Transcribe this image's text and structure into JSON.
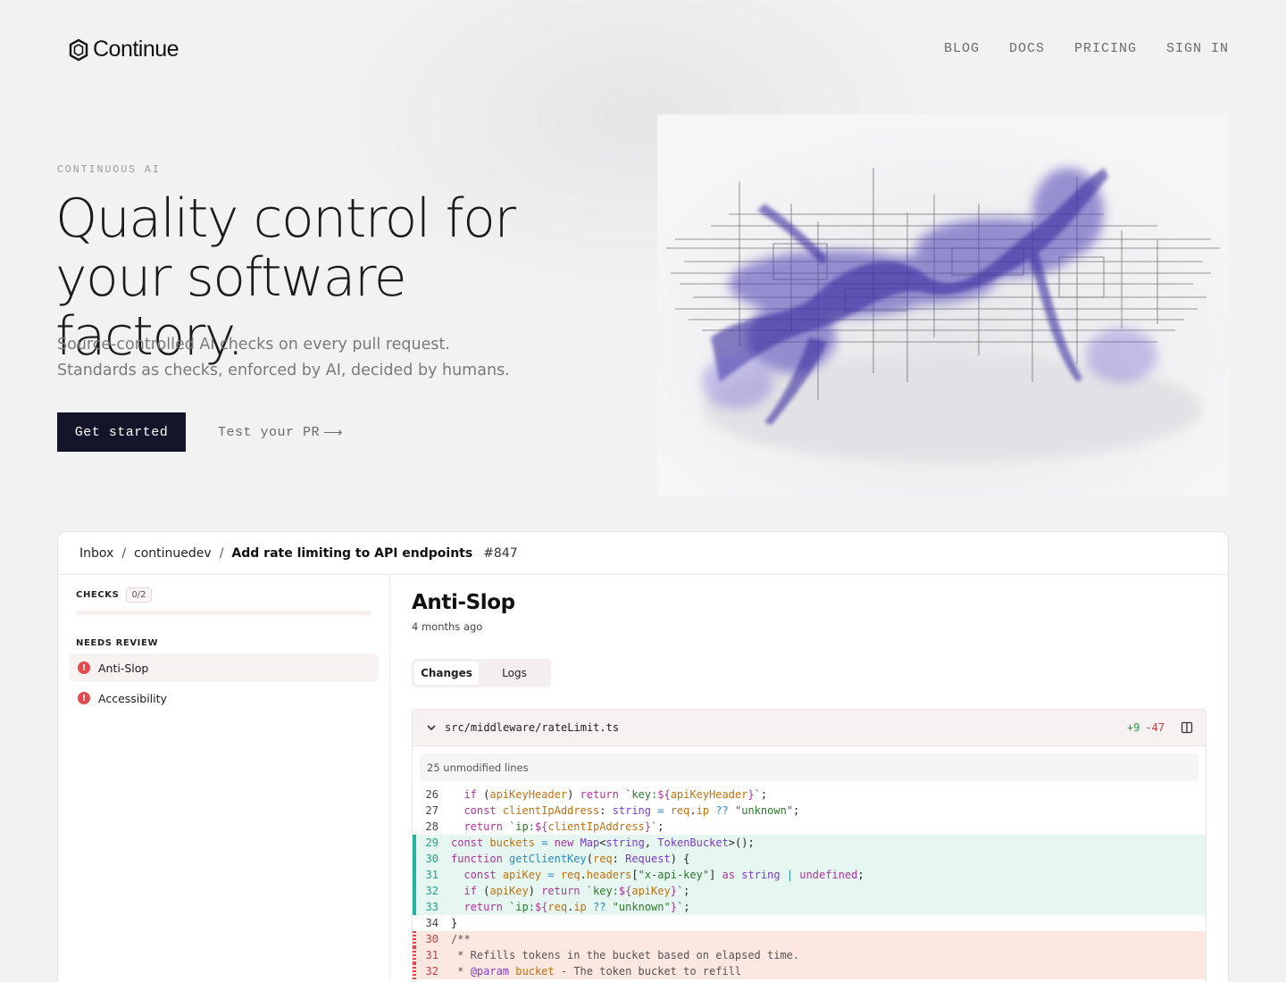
{
  "nav": {
    "brand": "Continue",
    "links": [
      "BLOG",
      "DOCS",
      "PRICING",
      "SIGN IN"
    ]
  },
  "hero": {
    "eyebrow": "CONTINUOUS AI",
    "headline_line1": "Quality control for",
    "headline_line2": "your software factory.",
    "subcopy": "Source-controlled AI checks on every pull request. Standards as checks, enforced by AI, decided by humans.",
    "cta_primary": "Get started",
    "cta_secondary": "Test your PR",
    "cta_arrow": "⟶"
  },
  "app": {
    "breadcrumb": {
      "inbox": "Inbox",
      "sep": "/",
      "org": "continuedev",
      "pr_title": "Add rate limiting to API endpoints",
      "pr_number": "#847"
    },
    "sidebar": {
      "checks_label": "CHECKS",
      "checks_count": "0/2",
      "checks_progress": 0.0,
      "needs_review_label": "NEEDS REVIEW",
      "items": [
        {
          "label": "Anti-Slop",
          "status": "error",
          "active": true
        },
        {
          "label": "Accessibility",
          "status": "error",
          "active": false
        }
      ]
    },
    "detail": {
      "title": "Anti-Slop",
      "time": "4 months ago",
      "tabs": [
        "Changes",
        "Logs"
      ],
      "active_tab": "Changes",
      "file": {
        "path": "src/middleware/rateLimit.ts",
        "additions": "+9",
        "deletions": "-47",
        "unmodified": "25 unmodified lines"
      }
    }
  },
  "colors": {
    "primary_button": "#14142b",
    "added_bg": "#e6f6f1",
    "removed_bg": "#fde7e1",
    "error": "#e5484d"
  }
}
